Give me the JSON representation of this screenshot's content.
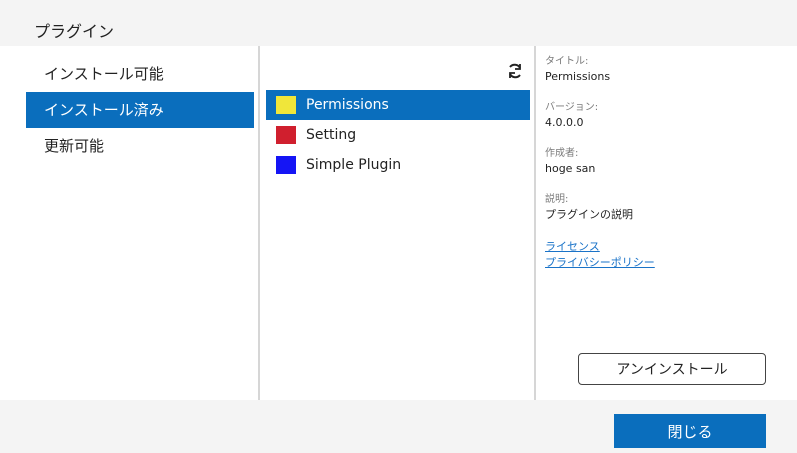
{
  "dialog": {
    "title": "プラグイン"
  },
  "categories": [
    {
      "label": "インストール可能",
      "selected": false
    },
    {
      "label": "インストール済み",
      "selected": true
    },
    {
      "label": "更新可能",
      "selected": false
    }
  ],
  "plugins": [
    {
      "name": "Permissions",
      "color": "#f0e63a",
      "selected": true
    },
    {
      "name": "Setting",
      "color": "#d01f2e",
      "selected": false
    },
    {
      "name": "Simple Plugin",
      "color": "#1515f5",
      "selected": false
    }
  ],
  "details": {
    "title_label": "タイトル:",
    "title_value": "Permissions",
    "version_label": "バージョン:",
    "version_value": "4.0.0.0",
    "author_label": "作成者:",
    "author_value": "hoge san",
    "desc_label": "説明:",
    "desc_value": "プラグインの説明",
    "license_link": "ライセンス",
    "privacy_link": "プライバシーポリシー",
    "uninstall_label": "アンインストール"
  },
  "footer": {
    "close_label": "閉じる"
  },
  "icons": {
    "refresh": "refresh-icon"
  }
}
